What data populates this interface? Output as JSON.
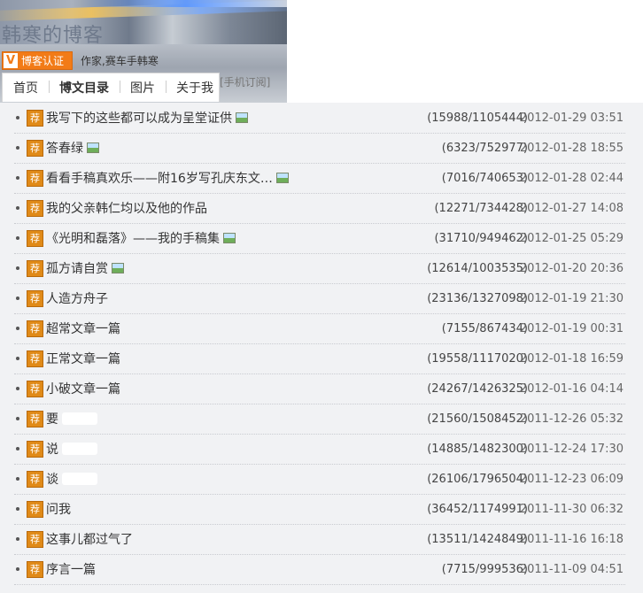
{
  "blog": {
    "title": "韩寒的博客",
    "badge_v": "V",
    "badge": "博客认证",
    "author": "作家,赛车手韩寒",
    "mobile": "[手机订阅]"
  },
  "nav": [
    "首页",
    "博文目录",
    "图片",
    "关于我"
  ],
  "recommend_char": "荐",
  "posts": [
    {
      "title": "我写下的这些都可以成为呈堂证供",
      "has_pic": true,
      "counts": "(15988/1105444)",
      "date": "2012-01-29 03:51"
    },
    {
      "title": "答春绿",
      "has_pic": true,
      "counts": "(6323/752977)",
      "date": "2012-01-28 18:55"
    },
    {
      "title": "看看手稿真欢乐——附16岁写孔庆东文…",
      "has_pic": true,
      "counts": "(7016/740653)",
      "date": "2012-01-28 02:44"
    },
    {
      "title": "我的父亲韩仁均以及他的作品",
      "has_pic": false,
      "counts": "(12271/734428)",
      "date": "2012-01-27 14:08"
    },
    {
      "title": "《光明和磊落》——我的手稿集",
      "has_pic": true,
      "counts": "(31710/949462)",
      "date": "2012-01-25 05:29"
    },
    {
      "title": "孤方请自赏",
      "has_pic": true,
      "counts": "(12614/1003535)",
      "date": "2012-01-20 20:36"
    },
    {
      "title": "人造方舟子",
      "has_pic": false,
      "counts": "(23136/1327098)",
      "date": "2012-01-19 21:30"
    },
    {
      "title": "超常文章一篇",
      "has_pic": false,
      "counts": "(7155/867434)",
      "date": "2012-01-19 00:31"
    },
    {
      "title": "正常文章一篇",
      "has_pic": false,
      "counts": "(19558/1117020)",
      "date": "2012-01-18 16:59"
    },
    {
      "title": "小破文章一篇",
      "has_pic": false,
      "counts": "(24267/1426325)",
      "date": "2012-01-16 04:14"
    },
    {
      "title": "要",
      "has_pic": false,
      "blurred": true,
      "counts": "(21560/1508452)",
      "date": "2011-12-26 05:32"
    },
    {
      "title": "说",
      "has_pic": false,
      "blurred": true,
      "counts": "(14885/1482300)",
      "date": "2011-12-24 17:30"
    },
    {
      "title": "谈",
      "has_pic": false,
      "blurred": true,
      "counts": "(26106/1796504)",
      "date": "2011-12-23 06:09"
    },
    {
      "title": "问我",
      "has_pic": false,
      "counts": "(36452/1174991)",
      "date": "2011-11-30 06:32"
    },
    {
      "title": "这事儿都过气了",
      "has_pic": false,
      "counts": "(13511/1424849)",
      "date": "2011-11-16 16:18"
    },
    {
      "title": "序言一篇",
      "has_pic": false,
      "counts": "(7715/999536)",
      "date": "2011-11-09 04:51"
    }
  ]
}
